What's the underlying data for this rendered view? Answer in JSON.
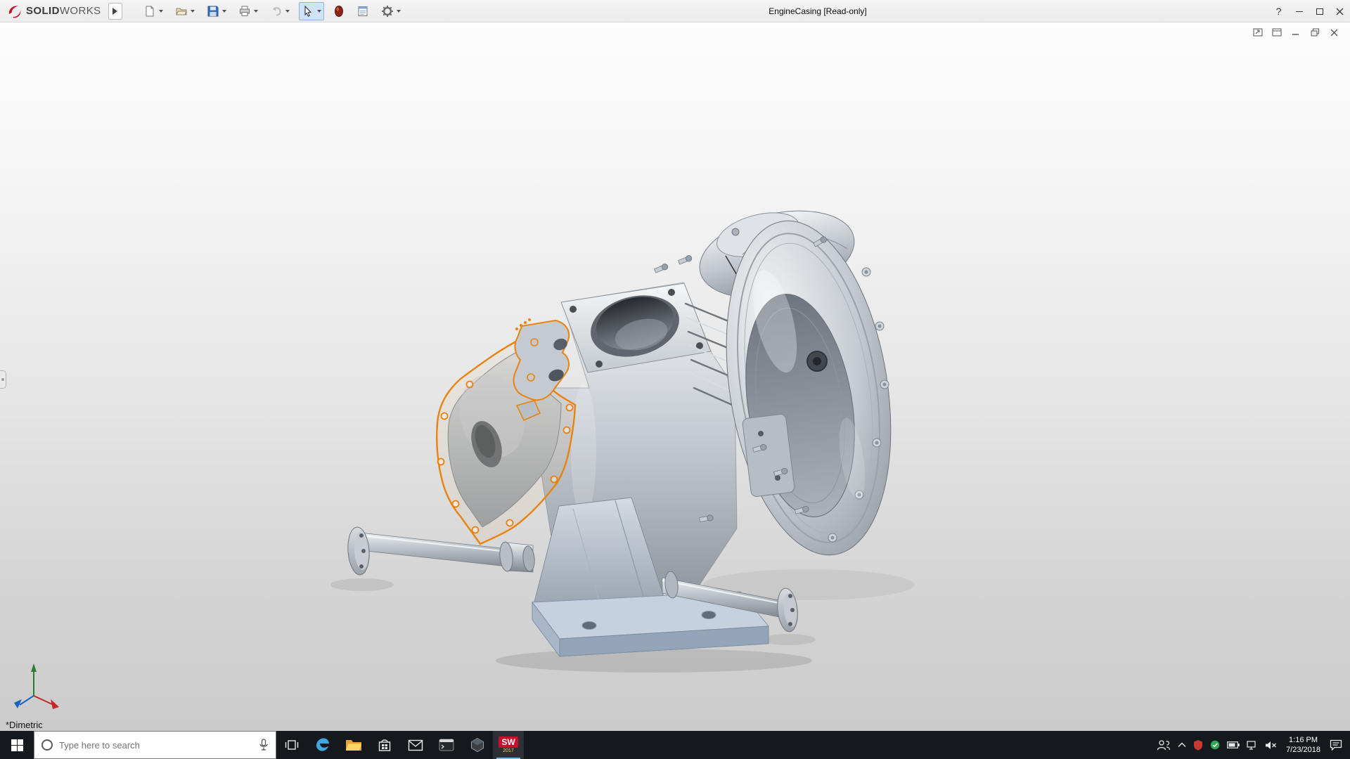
{
  "titlebar": {
    "brand_solid": "SOLID",
    "brand_works": "WORKS",
    "title": "EngineCasing [Read-only]",
    "help_glyph": "?"
  },
  "toolbar": {
    "items": [
      "new-document",
      "open",
      "save",
      "print",
      "undo",
      "select",
      "appearance",
      "file-properties",
      "options"
    ]
  },
  "viewport": {
    "orientation_label": "*Dimetric",
    "selected_part_color": "#e8830f"
  },
  "taskbar": {
    "search_placeholder": "Type here to search",
    "clock": {
      "time": "1:16 PM",
      "date": "7/23/2018"
    },
    "solidworks_app": {
      "letters": "SW",
      "year": "2017"
    }
  }
}
